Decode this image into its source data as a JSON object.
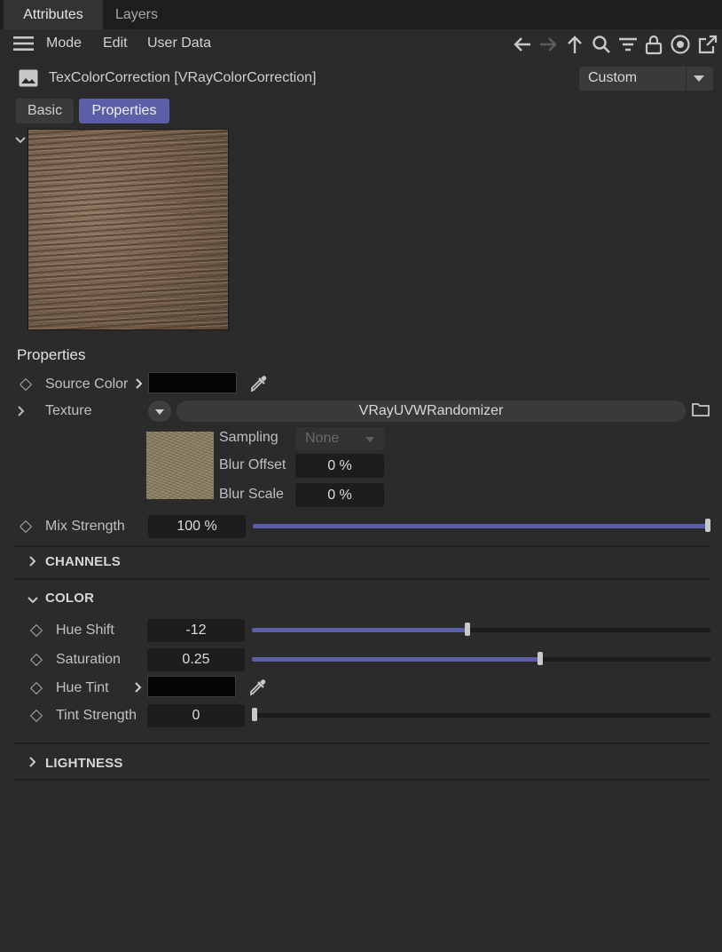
{
  "tabs": {
    "attributes": "Attributes",
    "layers": "Layers"
  },
  "menu": {
    "mode": "Mode",
    "edit": "Edit",
    "user_data": "User Data"
  },
  "toolbar_icons": [
    "back-arrow-icon",
    "forward-arrow-icon",
    "up-arrow-icon",
    "search-icon",
    "filter-icon",
    "lock-icon",
    "target-icon",
    "open-new-window-icon"
  ],
  "header": {
    "title": "TexColorCorrection [VRayColorCorrection]",
    "preset": "Custom"
  },
  "subtabs": {
    "basic": "Basic",
    "properties": "Properties"
  },
  "properties": {
    "section_title": "Properties",
    "source_color_label": "Source Color",
    "texture_label": "Texture",
    "texture_name": "VRayUVWRandomizer",
    "sampling_label": "Sampling",
    "sampling_value": "None",
    "blur_offset_label": "Blur Offset",
    "blur_offset_value": "0 %",
    "blur_scale_label": "Blur Scale",
    "blur_scale_value": "0 %",
    "mix_strength_label": "Mix Strength",
    "mix_strength_value": "100 %",
    "mix_strength_fraction": 1.0
  },
  "channels": {
    "title": "CHANNELS"
  },
  "color": {
    "title": "COLOR",
    "hue_shift_label": "Hue Shift",
    "hue_shift_value": "-12",
    "hue_shift_fraction": 0.47,
    "saturation_label": "Saturation",
    "saturation_value": "0.25",
    "saturation_fraction": 0.63,
    "hue_tint_label": "Hue Tint",
    "tint_strength_label": "Tint Strength",
    "tint_strength_value": "0",
    "tint_strength_fraction": 0.0
  },
  "lightness": {
    "title": "LIGHTNESS"
  },
  "colors": {
    "accent": "#5b5fa8",
    "swatch": "#050505"
  }
}
